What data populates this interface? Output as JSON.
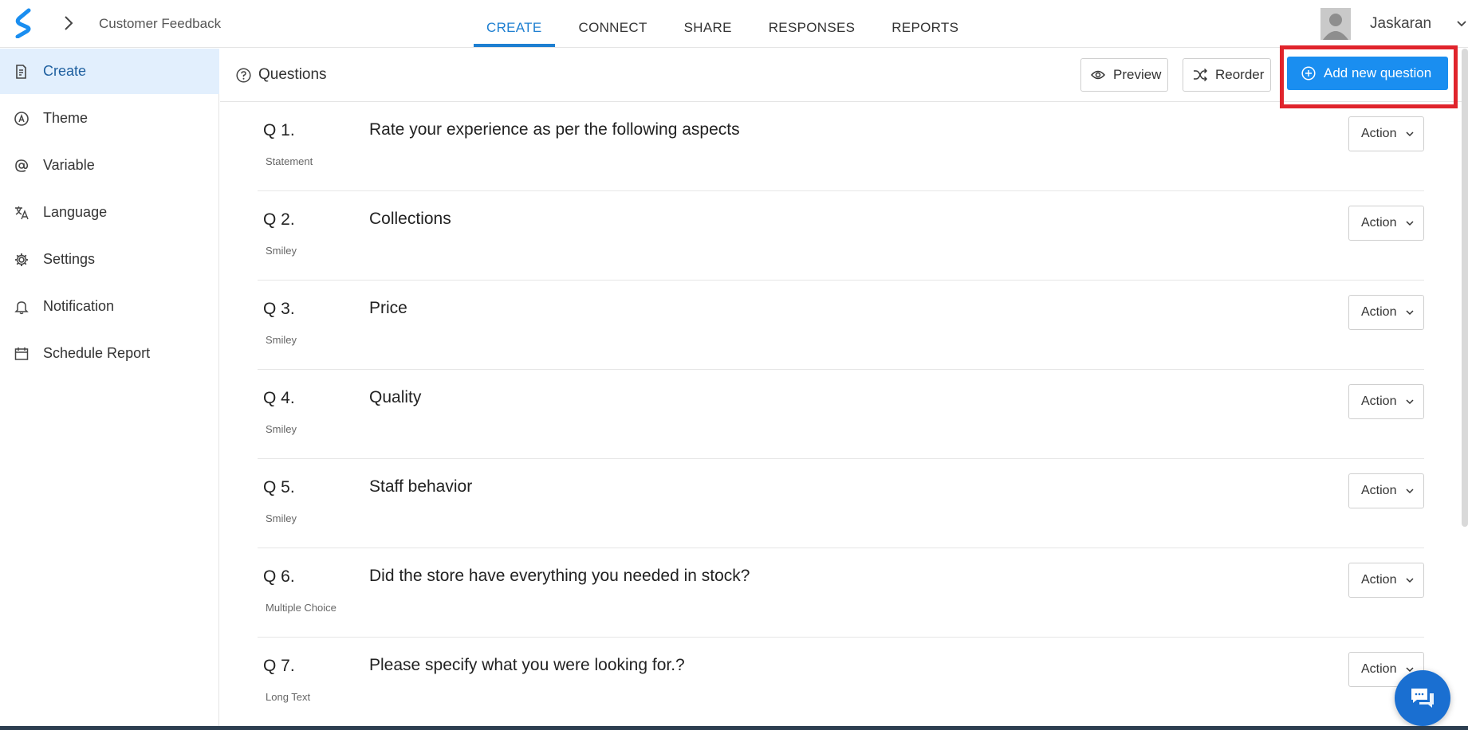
{
  "header": {
    "breadcrumb_title": "Customer Feedback",
    "nav_tabs": [
      {
        "label": "CREATE",
        "active": true
      },
      {
        "label": "CONNECT",
        "active": false
      },
      {
        "label": "SHARE",
        "active": false
      },
      {
        "label": "RESPONSES",
        "active": false
      },
      {
        "label": "REPORTS",
        "active": false
      }
    ],
    "username": "Jaskaran"
  },
  "sidebar": {
    "items": [
      {
        "label": "Create",
        "icon": "document-edit-icon",
        "active": true
      },
      {
        "label": "Theme",
        "icon": "theme-icon",
        "active": false
      },
      {
        "label": "Variable",
        "icon": "at-sign-icon",
        "active": false
      },
      {
        "label": "Language",
        "icon": "translate-icon",
        "active": false
      },
      {
        "label": "Settings",
        "icon": "gear-icon",
        "active": false
      },
      {
        "label": "Notification",
        "icon": "bell-icon",
        "active": false
      },
      {
        "label": "Schedule Report",
        "icon": "calendar-icon",
        "active": false
      }
    ]
  },
  "main": {
    "title": "Questions",
    "preview_label": "Preview",
    "reorder_label": "Reorder",
    "add_question_label": "Add new question",
    "action_label": "Action",
    "questions": [
      {
        "number": "Q 1.",
        "type": "Statement",
        "text": "Rate your experience as per the following aspects"
      },
      {
        "number": "Q 2.",
        "type": "Smiley",
        "text": "Collections"
      },
      {
        "number": "Q 3.",
        "type": "Smiley",
        "text": "Price"
      },
      {
        "number": "Q 4.",
        "type": "Smiley",
        "text": "Quality"
      },
      {
        "number": "Q 5.",
        "type": "Smiley",
        "text": "Staff behavior"
      },
      {
        "number": "Q 6.",
        "type": "Multiple Choice",
        "text": "Did the store have everything you needed in stock?"
      },
      {
        "number": "Q 7.",
        "type": "Long Text",
        "text": "Please specify what you were looking for.?"
      }
    ]
  },
  "colors": {
    "accent": "#1a8ef0",
    "active_tab": "#1e7fd1",
    "sidebar_active_bg": "#e2effd",
    "highlight": "#e0242c",
    "chat_button": "#1a6fd1"
  }
}
